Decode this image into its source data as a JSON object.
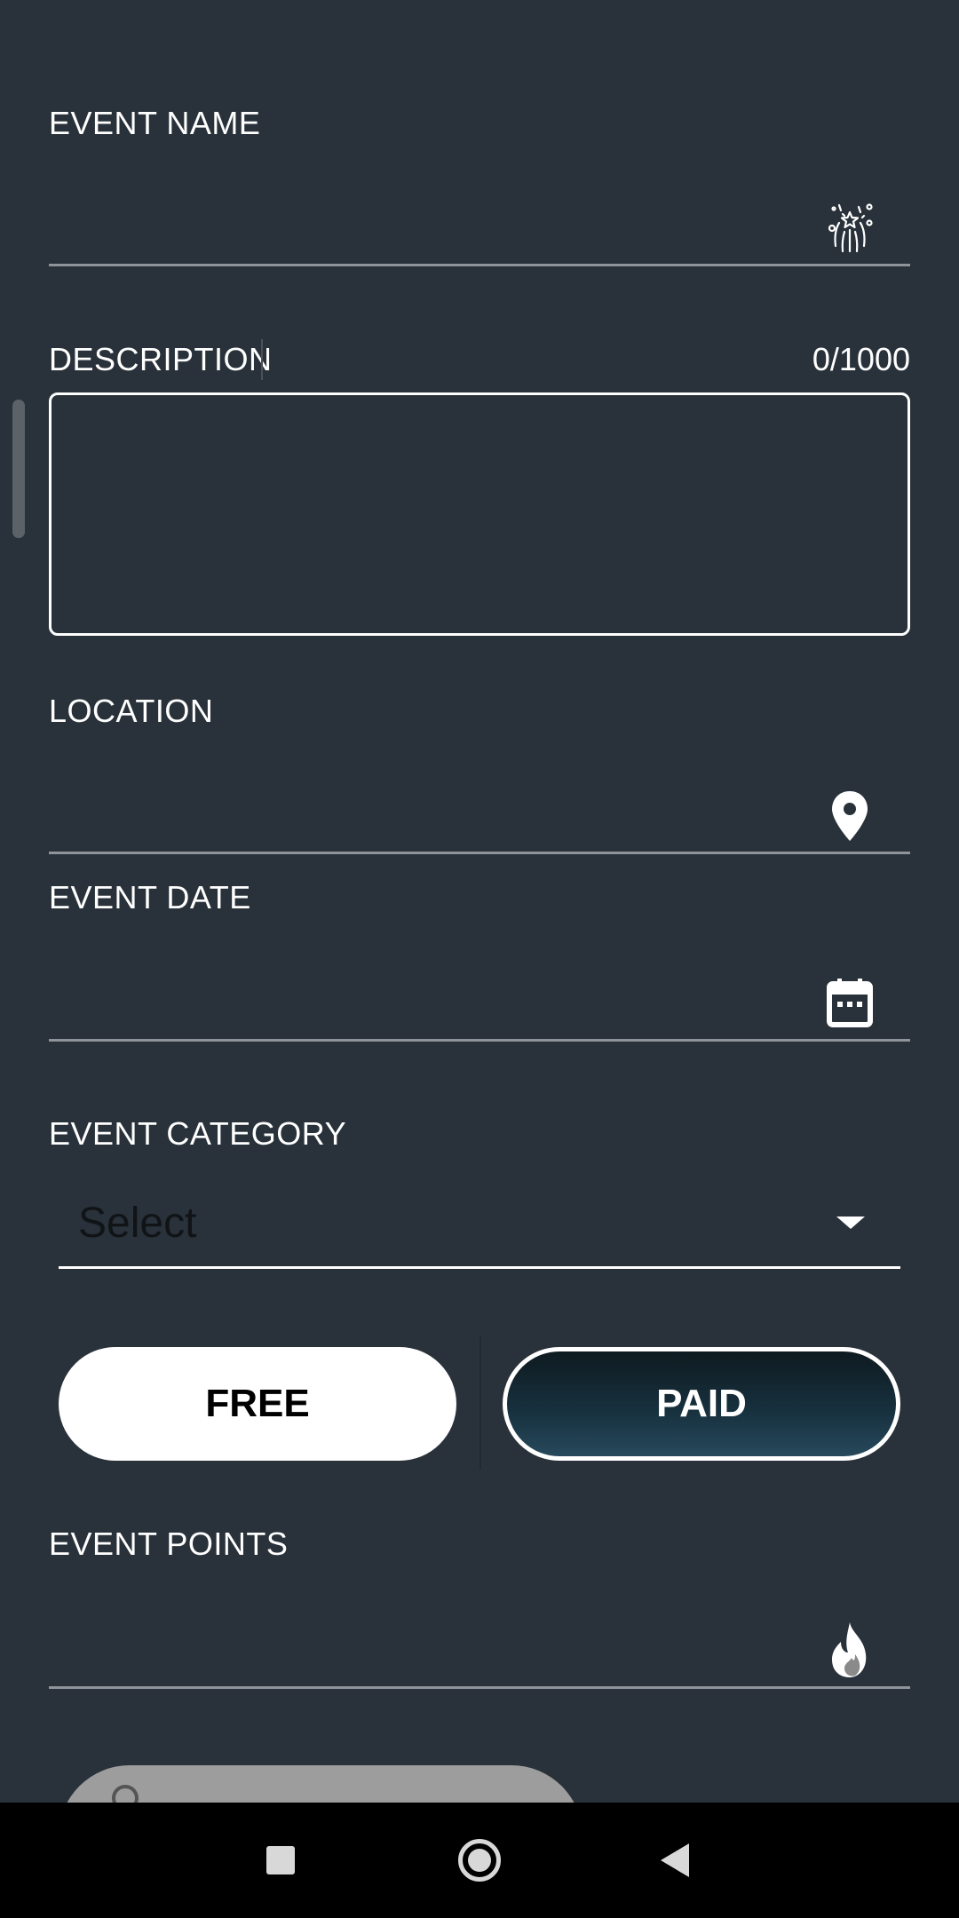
{
  "form": {
    "event_name": {
      "label": "EVENT NAME",
      "value": "",
      "icon": "fireworks-icon"
    },
    "description": {
      "label": "DESCRIPTION",
      "counter": "0/1000",
      "value": ""
    },
    "location": {
      "label": "LOCATION",
      "value": "",
      "icon": "location-pin-icon"
    },
    "event_date": {
      "label": "EVENT DATE",
      "value": "",
      "icon": "calendar-icon"
    },
    "event_category": {
      "label": "EVENT CATEGORY",
      "selected": "Select",
      "icon": "dropdown-arrow-icon"
    },
    "pricing": {
      "free_label": "FREE",
      "paid_label": "PAID",
      "selected": "PAID"
    },
    "event_points": {
      "label": "EVENT POINTS",
      "value": "",
      "icon": "flame-icon"
    }
  },
  "nav": {
    "recents": "square-icon",
    "home": "circle-icon",
    "back": "triangle-back-icon"
  },
  "colors": {
    "background": "#29323a",
    "paid_button_top": "#0e1a20",
    "paid_button_bottom": "#27495c",
    "field_underline": "#8e9499",
    "partial_button": "#9d9d9d"
  }
}
